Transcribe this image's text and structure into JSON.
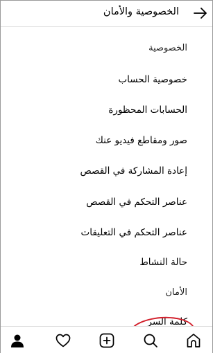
{
  "header": {
    "title": "الخصوصية والأمان",
    "back_icon": "arrow-right-icon"
  },
  "menu": {
    "privacy_section": "الخصوصية",
    "items": [
      "خصوصية الحساب",
      "الحسابات المحظورة",
      "صور ومقاطع فيديو عنك",
      "إعادة المشاركة في القصص",
      "عناصر التحكم في القصص",
      "عناصر التحكم في التعليقات",
      "حالة النشاط"
    ],
    "security_section": "الأمان",
    "password": "كلمة السر"
  },
  "highlight": {
    "target": "حالة النشاط",
    "color": "#d21f2b"
  },
  "tabbar": {
    "icons": [
      "profile-icon",
      "heart-icon",
      "add-post-icon",
      "search-icon",
      "home-icon"
    ]
  }
}
